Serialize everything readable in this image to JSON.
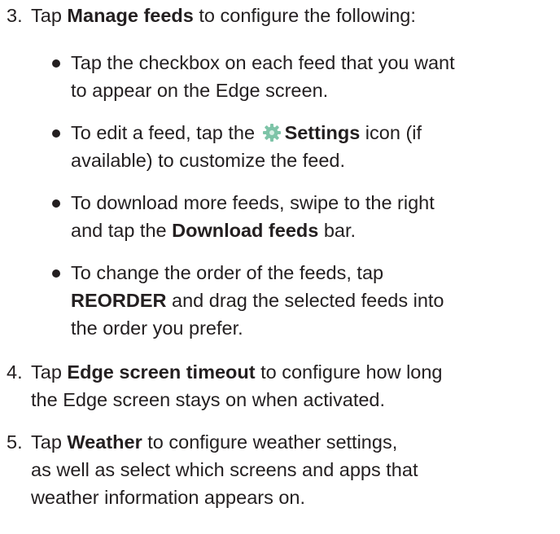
{
  "steps": [
    {
      "number": "3.",
      "pre": "Tap ",
      "bold": "Manage feeds",
      "post": " to configure the following:"
    },
    {
      "number": "4.",
      "pre": "Tap ",
      "bold": "Edge screen timeout",
      "post": " to configure how long",
      "line2": "the Edge screen stays on when activated."
    },
    {
      "number": "5.",
      "pre": "Tap ",
      "bold": "Weather",
      "post": " to configure weather settings,",
      "line2": "as well as select which screens and apps that",
      "line3": "weather information appears on."
    }
  ],
  "bullets": [
    {
      "line1": "Tap the checkbox on each feed that you want",
      "line2": "to appear on the Edge screen."
    },
    {
      "pre": "To edit a feed, tap the ",
      "icon": "gear-icon",
      "bold": "Settings",
      "post": " icon (if",
      "line2": "available) to customize the feed."
    },
    {
      "line1": "To download more feeds, swipe to the right",
      "line2_pre": "and tap the ",
      "line2_bold": "Download feeds",
      "line2_post": " bar."
    },
    {
      "line1": "To change the order of the feeds, tap",
      "line2_bold": "REORDER",
      "line2_post": " and drag the selected feeds into",
      "line3": "the order you prefer."
    }
  ],
  "colors": {
    "text": "#231f20",
    "gear_icon": "#7ec4a8"
  }
}
